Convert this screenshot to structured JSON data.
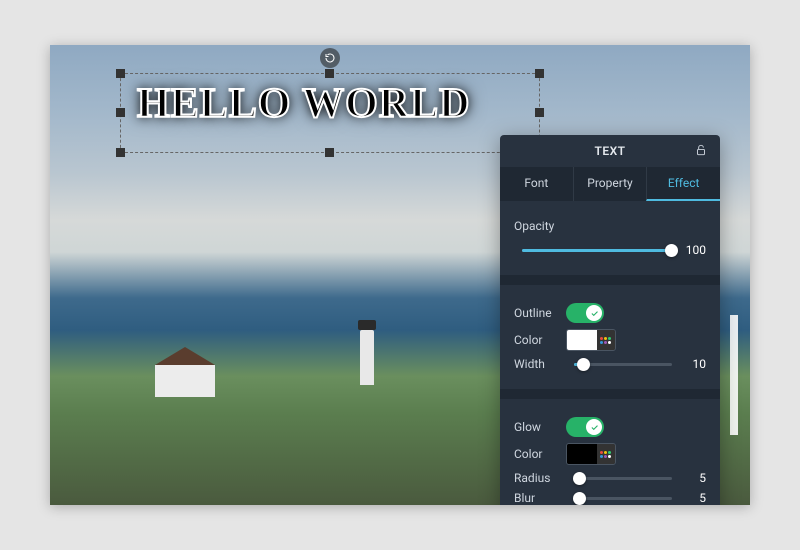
{
  "canvas_text": "HELLO WORLD",
  "panel": {
    "title": "TEXT",
    "tabs": {
      "font": "Font",
      "property": "Property",
      "effect": "Effect"
    },
    "opacity": {
      "label": "Opacity",
      "value": "100"
    },
    "outline": {
      "label": "Outline",
      "color_label": "Color",
      "color_value": "#ffffff",
      "width_label": "Width",
      "width_value": "10"
    },
    "glow": {
      "label": "Glow",
      "color_label": "Color",
      "color_value": "#000000",
      "radius_label": "Radius",
      "radius_value": "5",
      "blur_label": "Blur",
      "blur_value": "5"
    }
  }
}
